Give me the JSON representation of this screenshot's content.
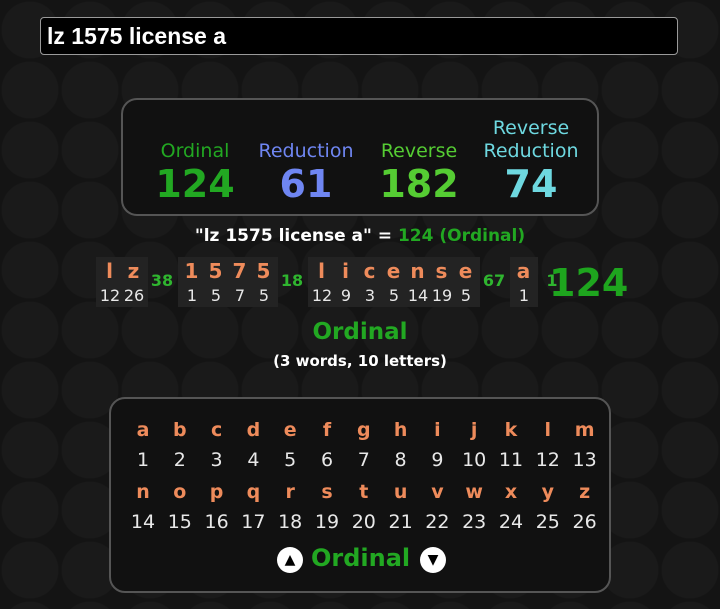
{
  "search": {
    "value": "lz 1575 license a"
  },
  "summary": {
    "ordinal_label": "Ordinal",
    "ordinal_value": "124",
    "reduction_label": "Reduction",
    "reduction_value": "61",
    "reverse_label": "Reverse",
    "reverse_value": "182",
    "reverse_reduction_label_1": "Reverse",
    "reverse_reduction_label_2": "Reduction",
    "reverse_reduction_value": "74"
  },
  "caption": {
    "phrase": "\"lz 1575 license a\"",
    "equals": " = ",
    "result": "124 (Ordinal)"
  },
  "breakdown": {
    "groups": [
      {
        "letters": [
          [
            "l",
            "12"
          ],
          [
            "z",
            "26"
          ]
        ],
        "sum": "38"
      },
      {
        "letters": [
          [
            "1",
            "1"
          ],
          [
            "5",
            "5"
          ],
          [
            "7",
            "7"
          ],
          [
            "5",
            "5"
          ]
        ],
        "sum": "18"
      },
      {
        "letters": [
          [
            "l",
            "12"
          ],
          [
            "i",
            "9"
          ],
          [
            "c",
            "3"
          ],
          [
            "e",
            "5"
          ],
          [
            "n",
            "14"
          ],
          [
            "s",
            "19"
          ],
          [
            "e",
            "5"
          ]
        ],
        "sum": "67"
      },
      {
        "letters": [
          [
            "a",
            "1"
          ]
        ],
        "sum": "1"
      }
    ],
    "total": "124"
  },
  "cipher_title": "Ordinal",
  "cipher_counts": "(3 words, 10 letters)",
  "cipher_chart": {
    "rows": [
      {
        "letters": [
          "a",
          "b",
          "c",
          "d",
          "e",
          "f",
          "g",
          "h",
          "i",
          "j",
          "k",
          "l",
          "m"
        ],
        "values": [
          "1",
          "2",
          "3",
          "4",
          "5",
          "6",
          "7",
          "8",
          "9",
          "10",
          "11",
          "12",
          "13"
        ]
      },
      {
        "letters": [
          "n",
          "o",
          "p",
          "q",
          "r",
          "s",
          "t",
          "u",
          "v",
          "w",
          "x",
          "y",
          "z"
        ],
        "values": [
          "14",
          "15",
          "16",
          "17",
          "18",
          "19",
          "20",
          "21",
          "22",
          "23",
          "24",
          "25",
          "26"
        ]
      }
    ],
    "name": "Ordinal",
    "prev_icon": "chevron-up-icon",
    "next_icon": "chevron-down-icon"
  },
  "colors": {
    "ordinal": "#22a822",
    "reduction": "#6f86f2",
    "reverse": "#55cc33",
    "reverse_reduction": "#6ed8e0",
    "letter": "#ee8b5b"
  }
}
